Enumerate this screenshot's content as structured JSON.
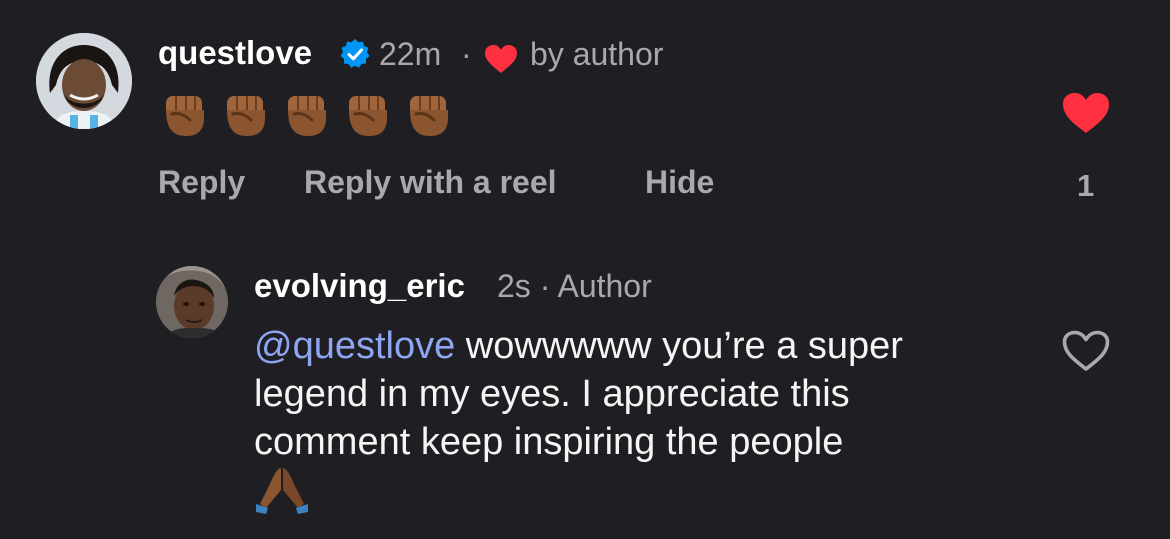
{
  "comment": {
    "username": "questlove",
    "verified_icon": "verified-badge-icon",
    "time": "22m",
    "separator": "·",
    "liked_by_author_label": "by author",
    "emoji": [
      "✊🏾",
      "✊🏾",
      "✊🏾",
      "✊🏾",
      "✊🏾"
    ],
    "actions": {
      "reply": "Reply",
      "reply_with_reel": "Reply with a reel",
      "hide": "Hide"
    },
    "like_count": "1",
    "liked": true
  },
  "reply": {
    "username": "evolving_eric",
    "meta": "2s · Author",
    "mention": "@questlove",
    "text": " wowwwww you’re a super legend in my eyes. I appreciate this comment keep inspiring the people",
    "emoji": "🙏🏾",
    "liked": false
  },
  "colors": {
    "background": "#1f1f23",
    "like_red": "#ff3040",
    "verified_blue": "#0095f6",
    "mention_blue": "#8ea6f2",
    "secondary_text": "#a8a8ad"
  }
}
